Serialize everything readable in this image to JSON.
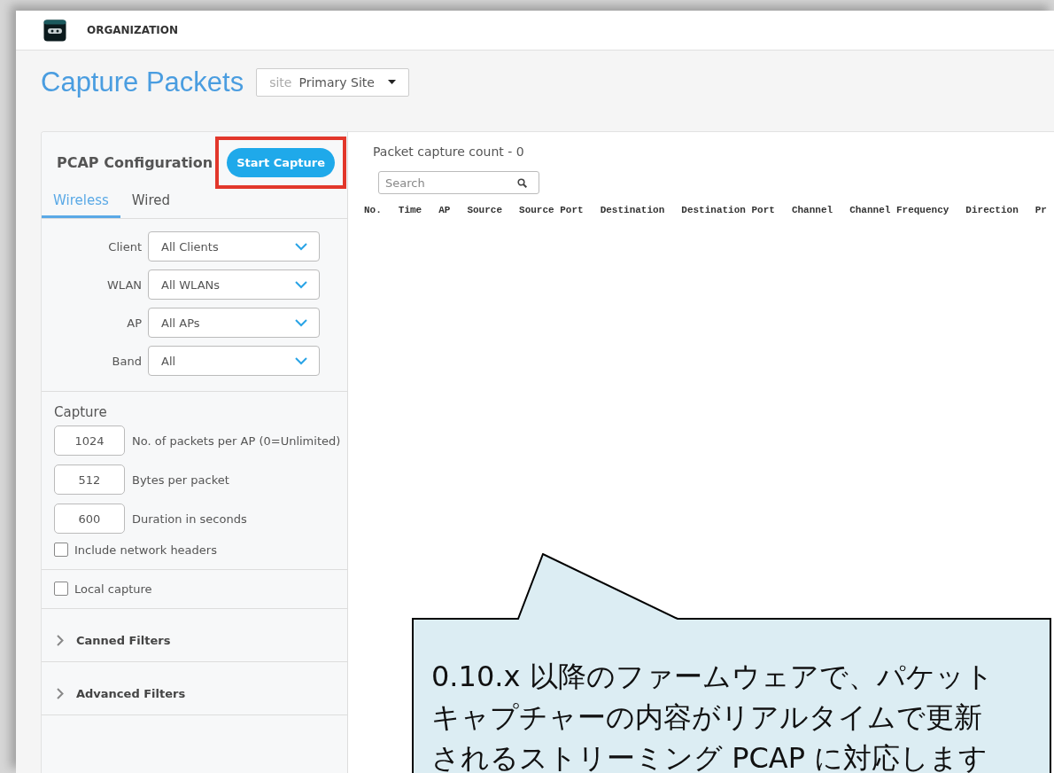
{
  "header": {
    "title": "ORGANIZATION"
  },
  "page": {
    "title": "Capture Packets",
    "site_selector": {
      "label": "site",
      "value": "Primary Site"
    }
  },
  "config": {
    "title": "PCAP Configuration",
    "start_button": {
      "label": "Start Capture",
      "highlighted": true
    },
    "tabs": [
      {
        "label": "Wireless",
        "selected": true
      },
      {
        "label": "Wired",
        "selected": false
      }
    ],
    "filters": [
      {
        "label": "Client",
        "value": "All Clients"
      },
      {
        "label": "WLAN",
        "value": "All WLANs"
      },
      {
        "label": "AP",
        "value": "All APs"
      },
      {
        "label": "Band",
        "value": "All"
      }
    ],
    "capture": {
      "title": "Capture",
      "fields": [
        {
          "value": "1024",
          "label": "No. of packets per AP (0=Unlimited)"
        },
        {
          "value": "512",
          "label": "Bytes per packet"
        },
        {
          "value": "600",
          "label": "Duration in seconds"
        }
      ],
      "include_headers": {
        "label": "Include network headers",
        "checked": false
      }
    },
    "local_capture": {
      "label": "Local capture",
      "checked": false
    },
    "sections": [
      {
        "label": "Canned Filters",
        "expanded": false
      },
      {
        "label": "Advanced Filters",
        "expanded": false
      }
    ]
  },
  "packets": {
    "count_label": "Packet capture count - 0",
    "search": {
      "placeholder": "Search"
    },
    "columns": [
      "No.",
      "Time",
      "AP",
      "Source",
      "Source Port",
      "Destination",
      "Destination Port",
      "Channel",
      "Channel Frequency",
      "Direction",
      "Pr"
    ]
  },
  "callout": {
    "lines": [
      "0.10.x 以降のファームウェアで、パケット",
      "キャプチャーの内容がリアルタイムで更新",
      "されるストリーミング PCAP に対応します"
    ]
  }
}
